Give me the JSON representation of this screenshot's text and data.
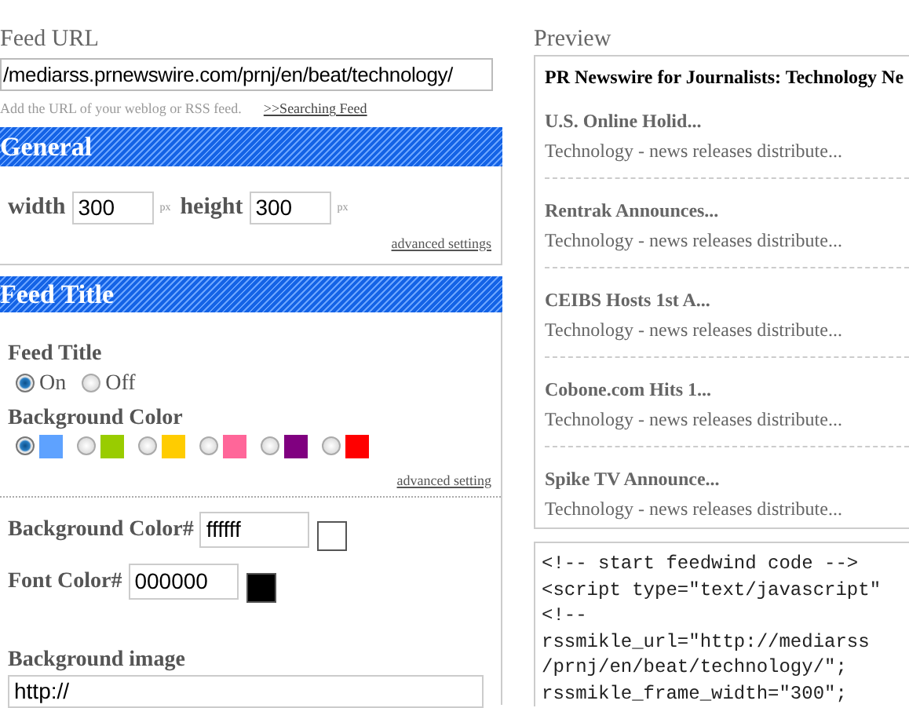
{
  "feed_url": {
    "label": "Feed URL",
    "value": "/mediarss.prnewswire.com/prnj/en/beat/technology/",
    "help": "Add the URL of your weblog or RSS feed.",
    "link": ">>Searching Feed"
  },
  "general": {
    "title": "General",
    "width_label": "width",
    "width_value": "300",
    "width_unit": "px",
    "height_label": "height",
    "height_value": "300",
    "height_unit": "px",
    "advanced_link": "advanced settings"
  },
  "feed_title": {
    "title": "Feed Title",
    "feed_title_label": "Feed Title",
    "options": [
      {
        "label": "On",
        "selected": true
      },
      {
        "label": "Off",
        "selected": false
      }
    ],
    "background_color_label": "Background Color",
    "swatches": [
      {
        "color": "#5ea2ff",
        "selected": true
      },
      {
        "color": "#99cc00",
        "selected": false
      },
      {
        "color": "#ffcc00",
        "selected": false
      },
      {
        "color": "#ff6699",
        "selected": false
      },
      {
        "color": "#800080",
        "selected": false
      },
      {
        "color": "#ff0000",
        "selected": false
      }
    ],
    "advanced_link": "advanced setting",
    "background_color_field": {
      "label": "Background Color#",
      "value": "ffffff",
      "color": "#ffffff"
    },
    "font_color_field": {
      "label": "Font Color#",
      "value": "000000",
      "color": "#000000"
    },
    "background_image": {
      "label": "Background image",
      "value": "http://"
    }
  },
  "preview": {
    "label": "Preview",
    "feed_title": "PR Newswire for Journalists: Technology Ne",
    "items": [
      {
        "title": "U.S. Online Holid...",
        "description": "Technology - news releases distribute..."
      },
      {
        "title": "Rentrak Announces...",
        "description": "Technology - news releases distribute..."
      },
      {
        "title": "CEIBS Hosts 1st A...",
        "description": "Technology - news releases distribute..."
      },
      {
        "title": "Cobone.com Hits 1...",
        "description": "Technology - news releases distribute..."
      },
      {
        "title": "Spike TV Announce...",
        "description": "Technology - news releases distribute..."
      }
    ]
  },
  "code": {
    "lines": [
      "<!-- start feedwind code -->",
      "<script type=\"text/javascript\"",
      "<!--",
      "rssmikle_url=\"http://mediarss",
      "/prnj/en/beat/technology/\";",
      "rssmikle_frame_width=\"300\";"
    ]
  }
}
